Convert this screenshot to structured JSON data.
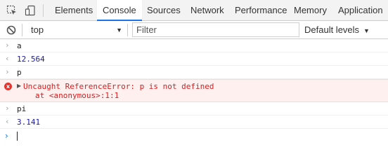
{
  "tabs": [
    {
      "label": "Elements"
    },
    {
      "label": "Console"
    },
    {
      "label": "Sources"
    },
    {
      "label": "Network"
    },
    {
      "label": "Performance"
    },
    {
      "label": "Memory"
    },
    {
      "label": "Application"
    }
  ],
  "toolbar": {
    "context": "top",
    "filter_placeholder": "Filter",
    "levels": "Default levels"
  },
  "console": {
    "entries": [
      {
        "kind": "input",
        "glyph": "›",
        "text": "a"
      },
      {
        "kind": "result",
        "glyph": "‹",
        "text": "12.564"
      },
      {
        "kind": "input",
        "glyph": "›",
        "text": "p"
      },
      {
        "kind": "error",
        "glyph": "x",
        "text": "Uncaught ReferenceError: p is not defined",
        "detail": "at <anonymous>:1:1"
      },
      {
        "kind": "input",
        "glyph": "›",
        "text": "pi"
      },
      {
        "kind": "result",
        "glyph": "‹",
        "text": "3.141"
      }
    ],
    "prompt_glyph": "›"
  },
  "icons": {
    "inspect": "cursor-select-icon",
    "device": "device-toggle-icon",
    "clear": "clear-console-icon",
    "dropdown": "triangle-down-icon",
    "error": "error-icon",
    "expand": "triangle-right-icon"
  },
  "colors": {
    "accent": "#1a73e8",
    "error_text": "#d71e1e",
    "error_bg": "#fff0f0",
    "result_text": "#1a1aa6"
  }
}
